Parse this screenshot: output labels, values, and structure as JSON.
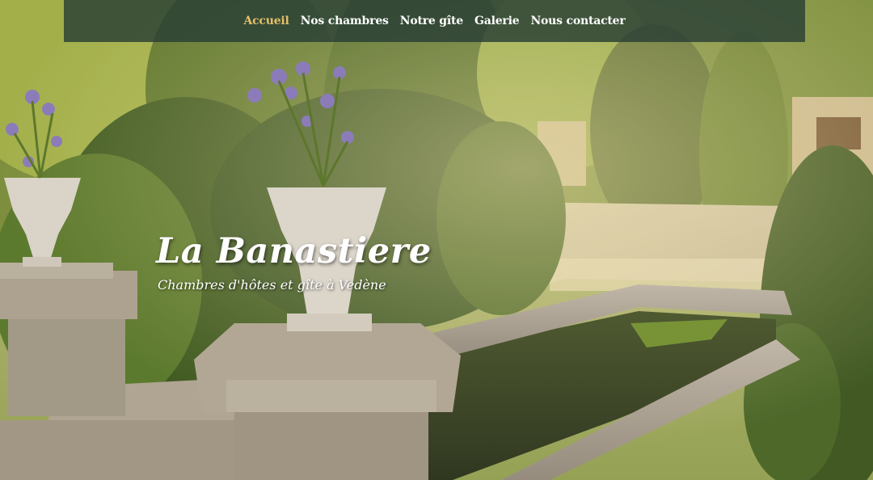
{
  "nav": {
    "items": [
      {
        "label": "Accueil",
        "active": true
      },
      {
        "label": "Nos chambres",
        "active": false
      },
      {
        "label": "Notre gîte",
        "active": false
      },
      {
        "label": "Galerie",
        "active": false
      },
      {
        "label": "Nous contacter",
        "active": false
      }
    ]
  },
  "hero": {
    "title": "La Banastiere",
    "subtitle": "Chambres d'hôtes et gîte à Vedène"
  },
  "colors": {
    "nav_background": "#283e34",
    "nav_active": "#e3c06a",
    "nav_text": "#ffffff"
  }
}
